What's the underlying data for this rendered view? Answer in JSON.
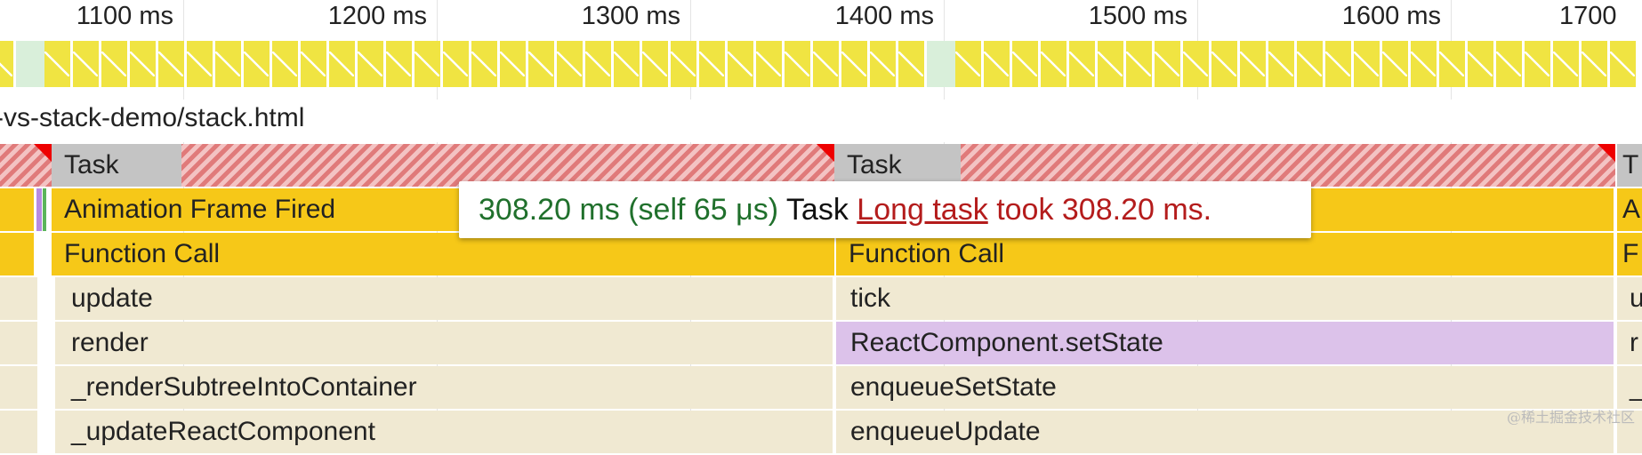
{
  "ruler": {
    "ticks": [
      "1100 ms",
      "1200 ms",
      "1300 ms",
      "1400 ms",
      "1500 ms",
      "1600 ms",
      "1700"
    ]
  },
  "frames": {
    "dropped_color": "#f0e442",
    "idle_color": "#d9efda"
  },
  "main": {
    "url_label": "-vs-stack-demo/stack.html",
    "rows": {
      "task": {
        "left_label": "Task",
        "right_label": "Task",
        "edge_label": "T"
      },
      "animation": {
        "left_label": "Animation Frame Fired",
        "edge_label": "A"
      },
      "function": {
        "left_label": "Function Call",
        "right_label": "Function Call",
        "edge_label": "F"
      },
      "level3": {
        "left_label": "update",
        "right_label": "tick",
        "edge_label": "u"
      },
      "level4": {
        "left_label": "render",
        "right_label": "ReactComponent.setState",
        "edge_label": "r"
      },
      "level5": {
        "left_label": "_renderSubtreeIntoContainer",
        "right_label": "enqueueSetState",
        "edge_label": "_"
      },
      "level6": {
        "left_label": "_updateReactComponent",
        "right_label": "enqueueUpdate"
      }
    }
  },
  "tooltip": {
    "duration": "308.20 ms (self 65 μs)",
    "entry": "Task",
    "link": "Long task",
    "message": "took 308.20 ms."
  },
  "colors": {
    "task_hatch": "#e07a7a",
    "scripting_yellow": "#f6c818",
    "duration_green": "#20702c",
    "warning_red": "#b41c1c",
    "react_purple": "#dcc2ea"
  },
  "watermark": "@稀土掘金技术社区"
}
